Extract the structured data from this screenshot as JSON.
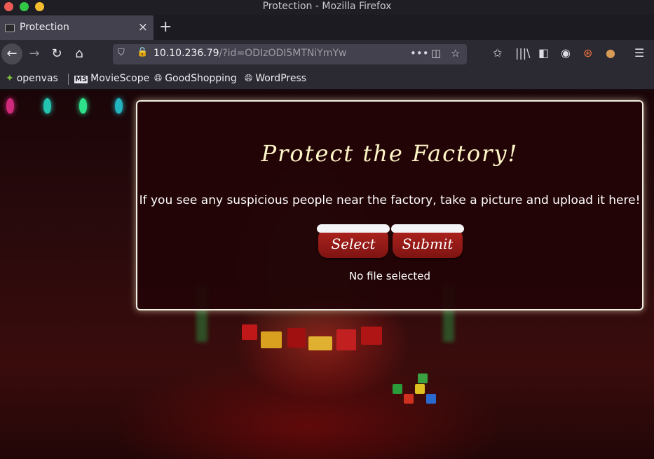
{
  "window": {
    "title": "Protection - Mozilla Firefox"
  },
  "tab": {
    "title": "Protection",
    "close": "×",
    "new_tab": "+"
  },
  "nav": {
    "back": "←",
    "forward": "→",
    "reload": "↻",
    "home": "⌂",
    "url_host": "10.10.236.79",
    "url_path": "/?id=ODIzODI5MTNiYmYw"
  },
  "bookmarks": [
    {
      "label": "openvas",
      "icon": "openvas-icon"
    },
    {
      "label": "MovieScope",
      "icon": "ms-icon"
    },
    {
      "label": "GoodShopping",
      "icon": "globe-icon"
    },
    {
      "label": "WordPress",
      "icon": "globe-icon"
    }
  ],
  "dialog": {
    "heading": "Protect the Factory!",
    "description": "If you see any suspicious people near the factory, take a picture and upload it here!",
    "select_label": "Select",
    "submit_label": "Submit",
    "file_status": "No file selected"
  },
  "colors": {
    "heading": "#fff6c7",
    "button": "#b0231e",
    "dialog_bg": "#230406"
  }
}
